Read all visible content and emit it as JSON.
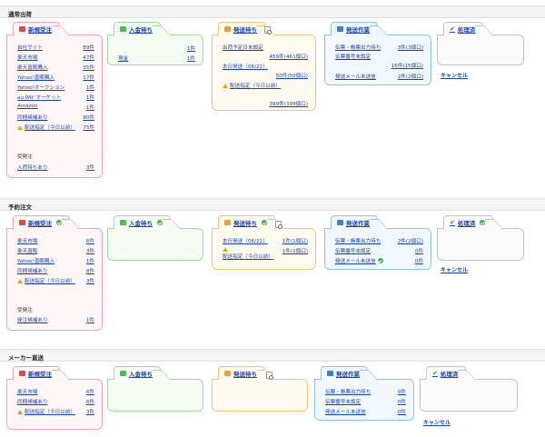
{
  "sections": [
    {
      "title": "通常出荷",
      "new_order": {
        "label": "新規受注",
        "rows": [
          {
            "label": "自社サイト",
            "count": "89件"
          },
          {
            "label": "楽天市場",
            "count": "47件"
          },
          {
            "label": "楽天直販購入",
            "count": "35件"
          },
          {
            "label": "Yahoo!直販購入",
            "count": "17件"
          },
          {
            "label": "Yahoo!オークション",
            "count": "1件"
          },
          {
            "label": "au PAY マーケット",
            "count": "1件"
          },
          {
            "label": "Amazon",
            "count": "1件"
          },
          {
            "label": "同梱候補あり",
            "count": "80件"
          },
          {
            "label": "配送指定（今日以前）",
            "count": "75件"
          }
        ],
        "pending_label": "受発注",
        "pending_row": {
          "label": "入荷待ちあり",
          "count": "3件"
        }
      },
      "payment_wait": {
        "label": "入金待ち",
        "rows": [
          {
            "label": "",
            "count": "1件"
          },
          {
            "label": "現金",
            "count": "1件"
          }
        ]
      },
      "ship_wait": {
        "label": "発送待ち",
        "rows": [
          {
            "label": "出荷予定日未設定",
            "count": ""
          },
          {
            "label": "",
            "count": "459件(461個口)"
          },
          {
            "label": "本日発送（08/22）",
            "count": ""
          },
          {
            "label": "",
            "count": "50件(50個口)"
          },
          {
            "label": "配送指定（今日以前）",
            "count": ""
          },
          {
            "label": "",
            "count": "399件(399個口)"
          }
        ]
      },
      "ship_work": {
        "label": "発送作業",
        "rows": [
          {
            "label": "伝票・帳票出力待ち",
            "count": "3件(3個口)"
          },
          {
            "label": "伝票番号未設定",
            "count": ""
          },
          {
            "label": "",
            "count": "15件(15個口)"
          },
          {
            "label": "発送メール未送信",
            "count": "2件(2個口)"
          }
        ]
      },
      "done": {
        "label": "処理済",
        "cancel": "キャンセル"
      }
    },
    {
      "title": "予約注文",
      "new_order": {
        "label": "新規受注",
        "rows": [
          {
            "label": "楽天市場",
            "count": "6件"
          },
          {
            "label": "楽天直販",
            "count": "3件"
          },
          {
            "label": "Yahoo!直販購入",
            "count": "1件"
          },
          {
            "label": "同梱候補あり",
            "count": "8件"
          },
          {
            "label": "配送指定（今日以前）",
            "count": "3件"
          }
        ],
        "pending_label": "受発注",
        "pending_row": {
          "label": "発注候補あり",
          "count": "1件"
        }
      },
      "payment_wait": {
        "label": "入金待ち",
        "rows": []
      },
      "ship_wait": {
        "label": "発送待ち",
        "rows": [
          {
            "label": "本日発送（08/22）",
            "count": "1件(1個口)"
          },
          {
            "label": "配送指定（今日以前）",
            "count": "1件(1個口)"
          }
        ]
      },
      "ship_work": {
        "label": "発送作業",
        "rows": [
          {
            "label": "伝票・帳票出力待ち",
            "count": "2件(2個口)"
          },
          {
            "label": "伝票番号未設定",
            "count": "0件"
          },
          {
            "label": "発送メール未送信",
            "count": "0件"
          }
        ]
      },
      "done": {
        "label": "処理済",
        "cancel": "キャンセル"
      }
    },
    {
      "title": "メーカー直送",
      "new_order": {
        "label": "新規受注",
        "rows": [
          {
            "label": "楽天市場",
            "count": "6件"
          },
          {
            "label": "同梱候補あり",
            "count": "6件"
          },
          {
            "label": "配送指定（今日以前）",
            "count": "3件"
          }
        ]
      },
      "payment_wait": {
        "label": "入金待ち",
        "rows": []
      },
      "ship_wait": {
        "label": "発送待ち",
        "rows": []
      },
      "ship_work": {
        "label": "発送作業",
        "rows": [
          {
            "label": "伝票・帳票出力待ち",
            "count": "0件"
          },
          {
            "label": "伝票番号未設定",
            "count": "0件"
          },
          {
            "label": "発送メール未送信",
            "count": "0件"
          }
        ]
      },
      "done": {
        "label": "処理済",
        "cancel": "キャンセル"
      }
    }
  ]
}
